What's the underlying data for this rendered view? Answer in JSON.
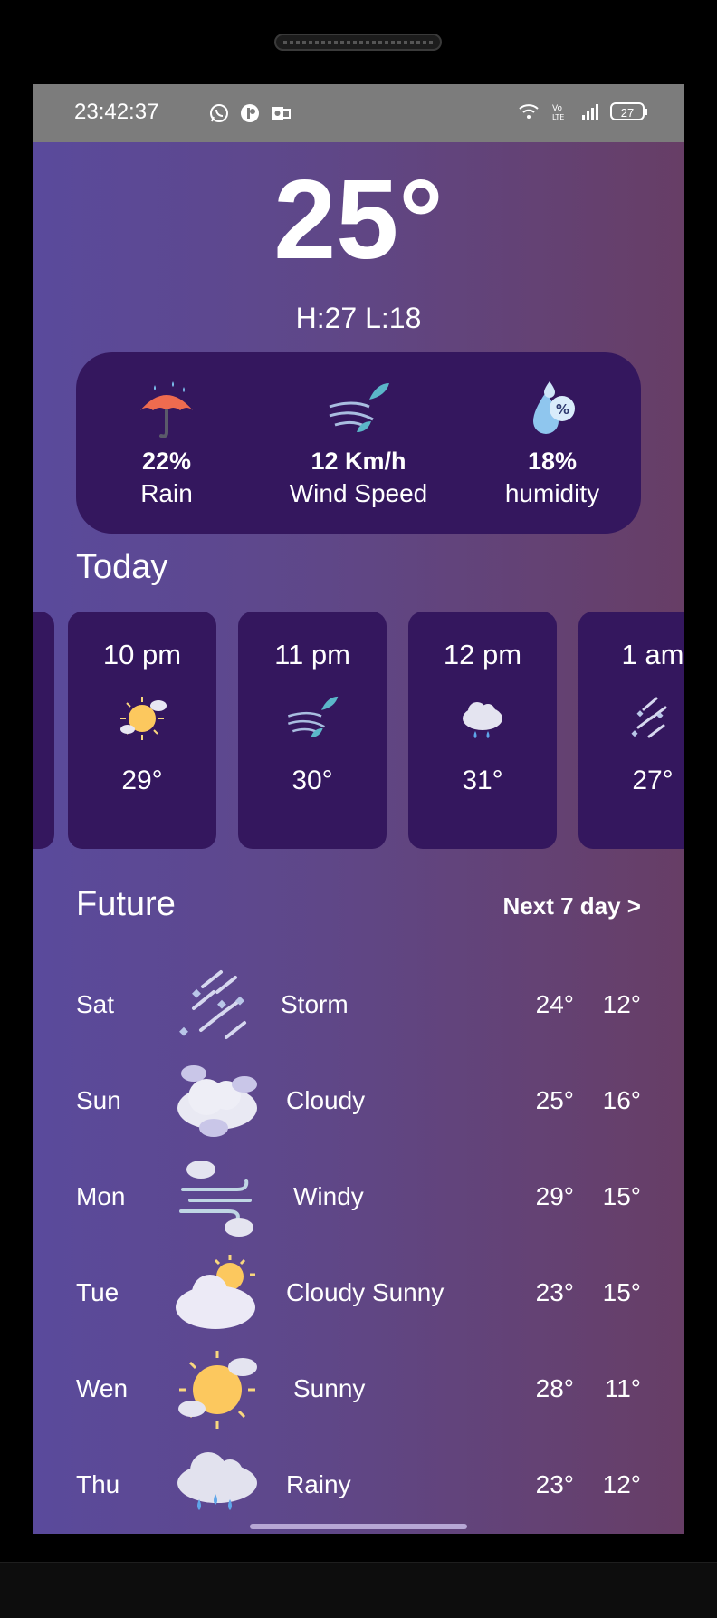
{
  "status": {
    "time": "23:42:37",
    "battery": "27"
  },
  "current": {
    "temp": "25°",
    "hilo": "H:27 L:18"
  },
  "stats": [
    {
      "icon": "umbrella-icon",
      "value": "22%",
      "label": "Rain"
    },
    {
      "icon": "wind-icon",
      "value": "12 Km/h",
      "label": "Wind Speed"
    },
    {
      "icon": "humidity-icon",
      "value": "18%",
      "label": "humidity"
    }
  ],
  "today": {
    "title": "Today",
    "hours": [
      {
        "time": "10 pm",
        "icon": "sunny-icon",
        "temp": "29°"
      },
      {
        "time": "11 pm",
        "icon": "wind-icon",
        "temp": "30°"
      },
      {
        "time": "12 pm",
        "icon": "rain-cloud-icon",
        "temp": "31°"
      },
      {
        "time": "1 am",
        "icon": "storm-icon",
        "temp": "27°"
      }
    ]
  },
  "future": {
    "title": "Future",
    "next_label": "Next 7 day >",
    "days": [
      {
        "day": "Sat",
        "icon": "storm-icon",
        "cond": "Storm",
        "hi": "24°",
        "lo": "12°"
      },
      {
        "day": "Sun",
        "icon": "cloudy-icon",
        "cond": "Cloudy",
        "hi": "25°",
        "lo": "16°"
      },
      {
        "day": "Mon",
        "icon": "windy-icon",
        "cond": "Windy",
        "hi": "29°",
        "lo": "15°"
      },
      {
        "day": "Tue",
        "icon": "cloudy-sunny-icon",
        "cond": "Cloudy Sunny",
        "hi": "23°",
        "lo": "15°"
      },
      {
        "day": "Wen",
        "icon": "sunny-icon",
        "cond": "Sunny",
        "hi": "28°",
        "lo": "11°"
      },
      {
        "day": "Thu",
        "icon": "rainy-icon",
        "cond": "Rainy",
        "hi": "23°",
        "lo": "12°"
      }
    ]
  }
}
